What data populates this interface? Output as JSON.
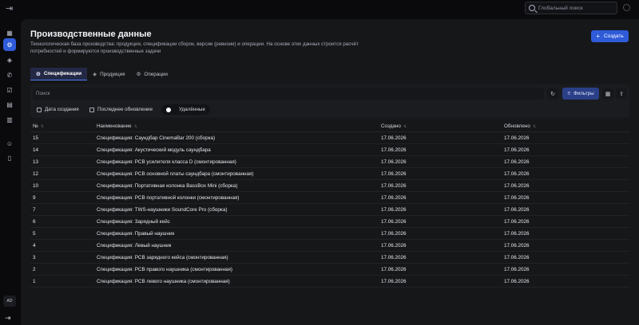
{
  "topbar": {
    "search_placeholder": "Глобальный поиск",
    "exit_icon": "exit-icon",
    "settings_icon": "settings-icon"
  },
  "sidebar": {
    "items": [
      {
        "icon": "dashboard-icon",
        "glyph": "▦",
        "active": false
      },
      {
        "icon": "gear-icon",
        "glyph": "⚙",
        "active": true
      },
      {
        "icon": "cubes-icon",
        "glyph": "◈",
        "active": false
      },
      {
        "icon": "phone-icon",
        "glyph": "✆",
        "active": false
      },
      {
        "icon": "checklist-icon",
        "glyph": "☑",
        "active": false
      },
      {
        "icon": "clipboard-icon",
        "glyph": "▤",
        "active": false
      },
      {
        "icon": "warehouse-icon",
        "glyph": "▥",
        "active": false
      },
      {
        "icon": "users-icon",
        "glyph": "☺",
        "active": false
      },
      {
        "icon": "device-icon",
        "glyph": "▯",
        "active": false
      }
    ],
    "avatar": "AD",
    "logout_glyph": "⇥"
  },
  "page": {
    "title": "Производственные данные",
    "subtitle": "Технологическая база производства: продукция, спецификации сборок, версии (ревизии) и операции. На основе этих данных строится расчёт потребностей и формируются производственные задачи",
    "create_label": "Создать"
  },
  "tabs": [
    {
      "label": "Спецификации",
      "active": true
    },
    {
      "label": "Продукция",
      "active": false
    },
    {
      "label": "Операции",
      "active": false
    }
  ],
  "toolbar": {
    "search_placeholder": "Поиск",
    "filters_label": "Фильтры",
    "chip_created": "Дата создания",
    "chip_updated": "Последнее обновление",
    "chip_deleted": "Удалённые"
  },
  "table": {
    "headers": [
      "№",
      "Наименование",
      "Создано",
      "Обновлено"
    ],
    "rows": [
      [
        "15",
        "Спецификация: Саундбар CinemaBar 200 (сборка)",
        "17.06.2026",
        "17.06.2026"
      ],
      [
        "14",
        "Спецификация: Акустический модуль саундбара",
        "17.06.2026",
        "17.06.2026"
      ],
      [
        "13",
        "Спецификация: PCB усилителя класса D (смонтированная)",
        "17.06.2026",
        "17.06.2026"
      ],
      [
        "12",
        "Спецификация: PCB основной платы саундбара (смонтированная)",
        "17.06.2026",
        "17.06.2026"
      ],
      [
        "10",
        "Спецификация: Портативная колонка BassBox Mini (сборка)",
        "17.06.2026",
        "17.06.2026"
      ],
      [
        "9",
        "Спецификация: PCB портативной колонки (смонтированная)",
        "17.06.2026",
        "17.06.2026"
      ],
      [
        "7",
        "Спецификация: TWS-наушники SoundCore Pro (сборка)",
        "17.06.2026",
        "17.06.2026"
      ],
      [
        "6",
        "Спецификация: Зарядный кейс",
        "17.06.2026",
        "17.06.2026"
      ],
      [
        "5",
        "Спецификация: Правый наушник",
        "17.06.2026",
        "17.06.2026"
      ],
      [
        "4",
        "Спецификация: Левый наушник",
        "17.06.2026",
        "17.06.2026"
      ],
      [
        "3",
        "Спецификация: PCB зарядного кейса (смонтированная)",
        "17.06.2026",
        "17.06.2026"
      ],
      [
        "2",
        "Спецификация: PCB правого наушника (смонтированная)",
        "17.06.2026",
        "17.06.2026"
      ],
      [
        "1",
        "Спецификация: PCB левого наушника (смонтированная)",
        "17.06.2026",
        "17.06.2026"
      ]
    ]
  },
  "colors": {
    "accent": "#2f5bd9",
    "background": "#0a0a0c",
    "panel": "#161719"
  }
}
